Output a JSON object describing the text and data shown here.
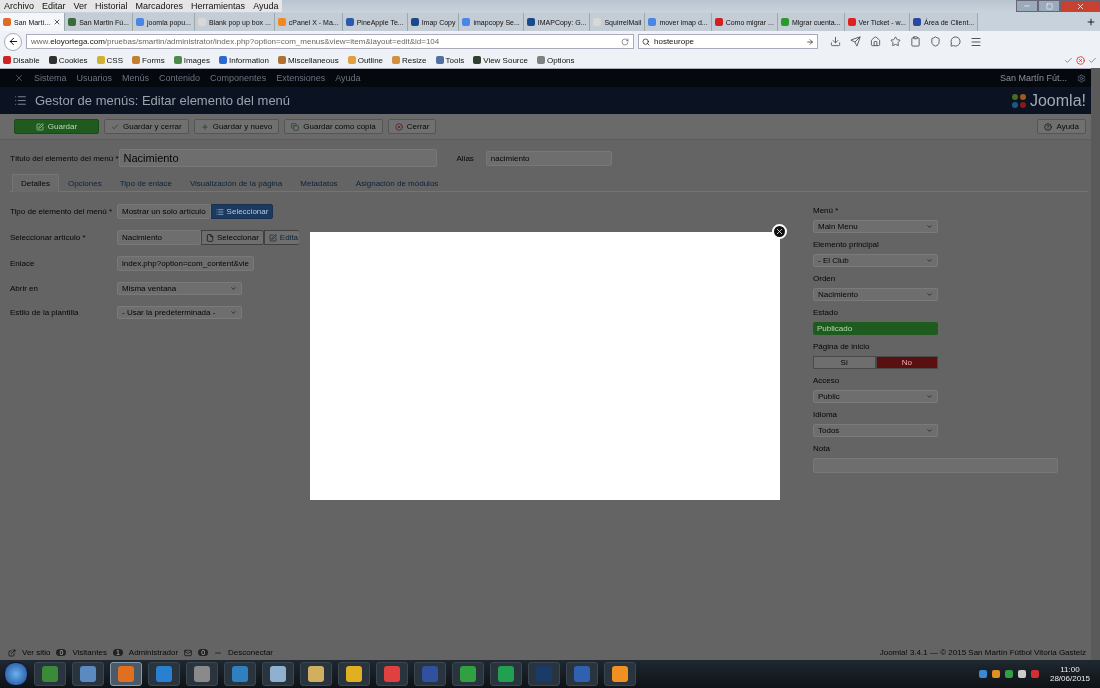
{
  "browser": {
    "menu": [
      "Archivo",
      "Editar",
      "Ver",
      "Historial",
      "Marcadores",
      "Herramientas",
      "Ayuda"
    ],
    "tabs": [
      {
        "label": "San Martí...",
        "selected": true,
        "color": "#e06a2a"
      },
      {
        "label": "San Martin Fú...",
        "selected": false,
        "color": "#3a6a3a"
      },
      {
        "label": "joomla popu...",
        "selected": false,
        "color": "#4a86e8"
      },
      {
        "label": "Blank pop up box ...",
        "selected": false,
        "color": "#d8d8d8"
      },
      {
        "label": "cPanel X - Ma...",
        "selected": false,
        "color": "#f08a20"
      },
      {
        "label": "PineApple Te...",
        "selected": false,
        "color": "#2a5ab0"
      },
      {
        "label": "Imap Copy",
        "selected": false,
        "color": "#1a4a8a"
      },
      {
        "label": "imapcopy Se...",
        "selected": false,
        "color": "#4a86e8"
      },
      {
        "label": "IMAPCopy: G...",
        "selected": false,
        "color": "#1a4a8a"
      },
      {
        "label": "SquirrelMail",
        "selected": false,
        "color": "#d8d8d8"
      },
      {
        "label": "mover imap d...",
        "selected": false,
        "color": "#4a86e8"
      },
      {
        "label": "Como migrar ...",
        "selected": false,
        "color": "#d02020"
      },
      {
        "label": "Migrar cuenta...",
        "selected": false,
        "color": "#2a9a2a"
      },
      {
        "label": "Ver Ticket - w...",
        "selected": false,
        "color": "#e02020"
      },
      {
        "label": "Área de Client...",
        "selected": false,
        "color": "#2a4aa0"
      }
    ],
    "url": "www.**eloyortega.com**/pruebas/smartin/administrator/index.php?option=com_menus&view=item&layout=edit&id=104",
    "search": "hosteurope",
    "devtools": [
      {
        "label": "Disable",
        "color": "#d02020"
      },
      {
        "label": "Cookies",
        "color": "#303030"
      },
      {
        "label": "CSS",
        "color": "#d0b030"
      },
      {
        "label": "Forms",
        "color": "#c08030"
      },
      {
        "label": "Images",
        "color": "#4a8a4a"
      },
      {
        "label": "Information",
        "color": "#2a6ad0"
      },
      {
        "label": "Miscellaneous",
        "color": "#b07030"
      },
      {
        "label": "Outline",
        "color": "#e0a040"
      },
      {
        "label": "Resize",
        "color": "#d09040"
      },
      {
        "label": "Tools",
        "color": "#5070a0"
      },
      {
        "label": "View Source",
        "color": "#304030"
      },
      {
        "label": "Options",
        "color": "#808080"
      }
    ]
  },
  "admin": {
    "nav": [
      "Sistema",
      "Usuarios",
      "Menús",
      "Contenido",
      "Componentes",
      "Extensiones",
      "Ayuda"
    ],
    "site_link": "San Martín Fút...",
    "title": "Gestor de menús: Editar elemento del menú",
    "logo": "Joomla!",
    "buttons": [
      {
        "label": "Guardar",
        "kind": "primary"
      },
      {
        "label": "Guardar y cerrar",
        "kind": "default"
      },
      {
        "label": "Guardar y nuevo",
        "kind": "default"
      },
      {
        "label": "Guardar como copia",
        "kind": "default"
      },
      {
        "label": "Cerrar",
        "kind": "default"
      }
    ],
    "help": "Ayuda",
    "title_field": {
      "label": "Título del elemento del menú *",
      "value": "Nacimiento"
    },
    "alias": {
      "label": "Alias",
      "value": "nacimiento"
    },
    "tabs": [
      {
        "label": "Detalles",
        "selected": true
      },
      {
        "label": "Opciones",
        "selected": false
      },
      {
        "label": "Tipo de enlace",
        "selected": false
      },
      {
        "label": "Visualización de la página",
        "selected": false
      },
      {
        "label": "Metadatos",
        "selected": false
      },
      {
        "label": "Asignación de módulos",
        "selected": false
      }
    ],
    "fields": [
      {
        "label": "Tipo de elemento del menú *",
        "kind": "picker",
        "value": "Mostrar un solo artículo",
        "buttons": [
          "Seleccionar"
        ]
      },
      {
        "label": "Seleccionar artículo *",
        "kind": "modal",
        "value": "Nacimiento",
        "buttons": [
          "Seleccionar",
          "Edita"
        ]
      },
      {
        "label": "Enlace",
        "kind": "text",
        "value": "index.php?option=com_content&vie"
      },
      {
        "label": "Abrir en",
        "kind": "select",
        "value": "Misma ventana"
      },
      {
        "label": "Estilo de la plantilla",
        "kind": "select",
        "value": "- Usar la predeterminada -"
      }
    ],
    "side": [
      {
        "label": "Menú *",
        "kind": "select",
        "value": "Main Menu"
      },
      {
        "label": "Elemento principal",
        "kind": "select",
        "value": "- El Club"
      },
      {
        "label": "Orden",
        "kind": "select",
        "value": "Nacimiento"
      },
      {
        "label": "Estado",
        "kind": "status",
        "value": "Publicado"
      },
      {
        "label": "Página de inicio",
        "kind": "toggle",
        "options": [
          {
            "label": "Sí",
            "selected": false
          },
          {
            "label": "No",
            "selected": true
          }
        ]
      },
      {
        "label": "Acceso",
        "kind": "select",
        "value": "Public"
      },
      {
        "label": "Idioma",
        "kind": "select",
        "value": "Todos"
      },
      {
        "label": "Nota",
        "kind": "text"
      }
    ],
    "footer": [
      {
        "kind": "link",
        "label": "Ver sitio"
      },
      {
        "kind": "count",
        "count": "0",
        "label": "Visitantes"
      },
      {
        "kind": "count",
        "count": "1",
        "label": "Administrador"
      },
      {
        "kind": "mail",
        "count": "0"
      },
      {
        "kind": "logout",
        "label": "Desconectar"
      }
    ],
    "copyright": "Joomla! 3.4.1 — © 2015 San Martín Fútbol Vitoria Gasteiz"
  },
  "taskbar": {
    "apps": [
      {
        "color": "#3a8a3a",
        "selected": false
      },
      {
        "color": "#5a8ac0",
        "selected": false
      },
      {
        "color": "#e07020",
        "selected": true
      },
      {
        "color": "#2a80d0",
        "selected": false
      },
      {
        "color": "#8a8a8a",
        "selected": false
      },
      {
        "color": "#3080c0",
        "selected": false
      },
      {
        "color": "#90b0d0",
        "selected": false
      },
      {
        "color": "#d0b060",
        "selected": false
      },
      {
        "color": "#e0b020",
        "selected": false
      },
      {
        "color": "#e04040",
        "selected": false
      },
      {
        "color": "#3050a0",
        "selected": false
      },
      {
        "color": "#30a040",
        "selected": false
      },
      {
        "color": "#20a050",
        "selected": false
      },
      {
        "color": "#1a3a6a",
        "selected": false
      },
      {
        "color": "#3060b0",
        "selected": false
      },
      {
        "color": "#f09020",
        "selected": false
      }
    ],
    "time": "11:00",
    "date": "28/06/2015"
  }
}
